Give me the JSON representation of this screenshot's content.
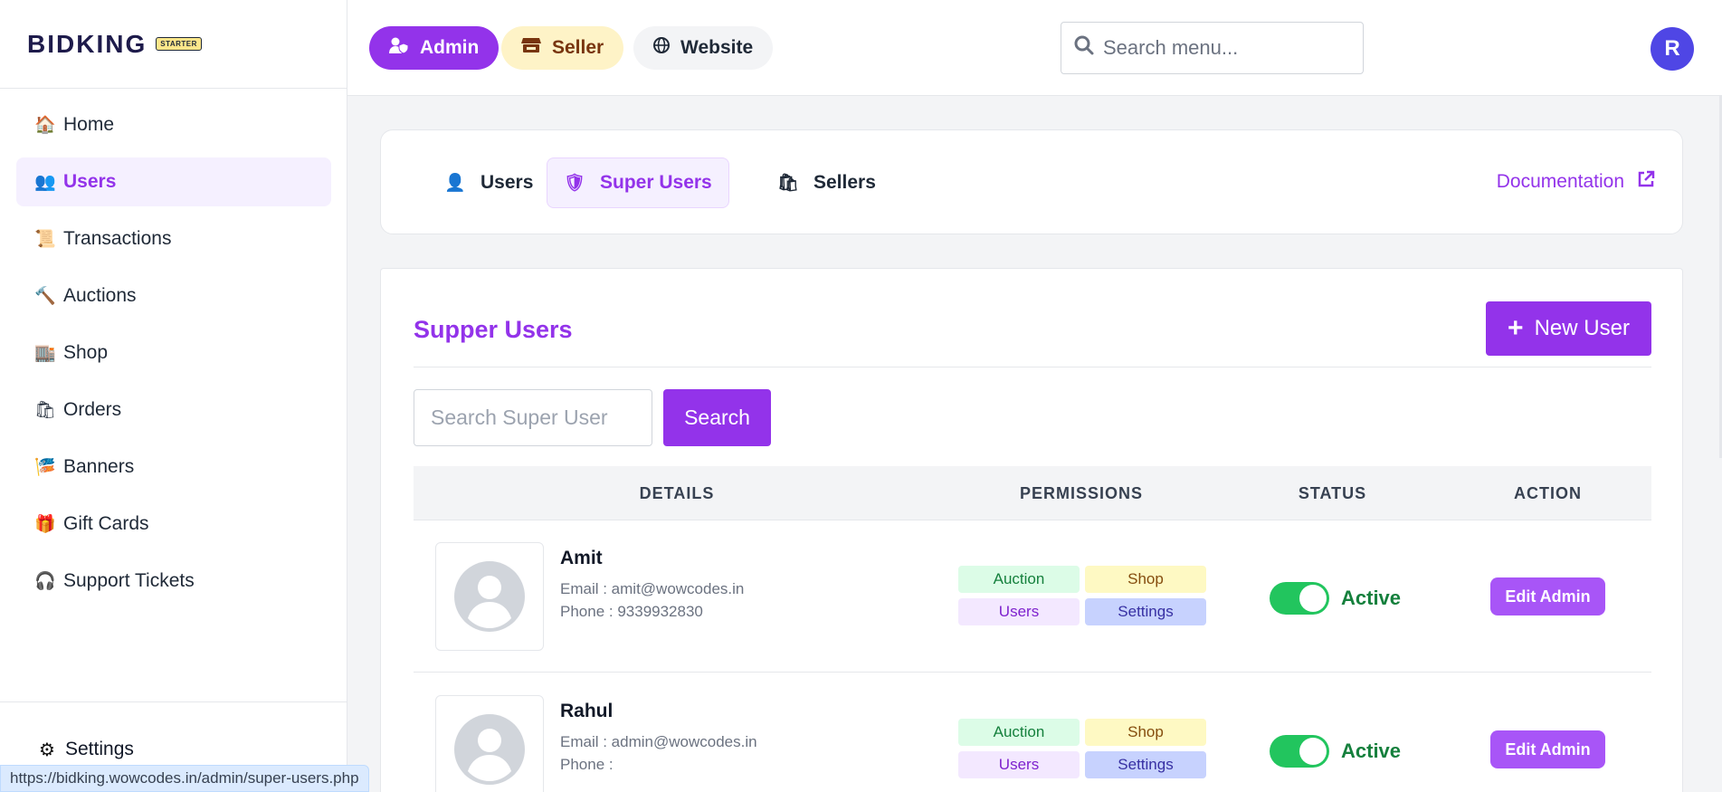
{
  "brand": {
    "name": "BIDKING",
    "badge": "STARTER"
  },
  "sidebar": {
    "items": [
      {
        "label": "Home",
        "icon": "house-icon",
        "active": false
      },
      {
        "label": "Users",
        "icon": "users-icon",
        "active": true
      },
      {
        "label": "Transactions",
        "icon": "scroll-icon",
        "active": false
      },
      {
        "label": "Auctions",
        "icon": "hammer-icon",
        "active": false
      },
      {
        "label": "Shop",
        "icon": "building-icon",
        "active": false
      },
      {
        "label": "Orders",
        "icon": "shopping-bags-icon",
        "active": false
      },
      {
        "label": "Banners",
        "icon": "banner-icon",
        "active": false
      },
      {
        "label": "Gift Cards",
        "icon": "gift-icon",
        "active": false
      },
      {
        "label": "Support Tickets",
        "icon": "headphones-icon",
        "active": false
      }
    ],
    "settings_label": "Settings"
  },
  "status_url": "https://bidking.wowcodes.in/admin/super-users.php",
  "topbar": {
    "admin_label": "Admin",
    "seller_label": "Seller",
    "website_label": "Website",
    "search_placeholder": "Search menu...",
    "avatar_initial": "R"
  },
  "tabs": {
    "users": "Users",
    "super_users": "Super Users",
    "sellers": "Sellers",
    "documentation": "Documentation"
  },
  "main": {
    "title": "Supper Users",
    "new_user_label": "New User",
    "search_placeholder": "Search Super User",
    "search_button": "Search",
    "columns": [
      "DETAILS",
      "PERMISSIONS",
      "STATUS",
      "ACTION"
    ],
    "rows": [
      {
        "name": "Amit",
        "email": "Email : amit@wowcodes.in",
        "phone": "Phone : 9339932830",
        "permissions": [
          "Auction",
          "Shop",
          "Users",
          "Settings"
        ],
        "status": "Active",
        "action": "Edit Admin"
      },
      {
        "name": "Rahul",
        "email": "Email : admin@wowcodes.in",
        "phone": "Phone :",
        "permissions": [
          "Auction",
          "Shop",
          "Users",
          "Settings"
        ],
        "status": "Active",
        "action": "Edit Admin"
      }
    ]
  },
  "colors": {
    "accent": "#9333ea",
    "active_green": "#22c55e",
    "avatar": "#4f46e5"
  }
}
